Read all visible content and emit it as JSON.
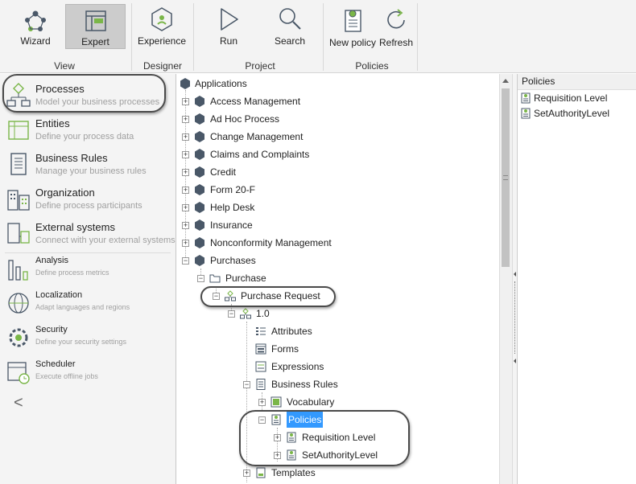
{
  "ribbon": {
    "buttons": {
      "wizard": "Wizard",
      "expert": "Expert",
      "experience": "Experience",
      "run": "Run",
      "search": "Search",
      "new_policy": "New policy",
      "refresh": "Refresh"
    },
    "groups": {
      "view": "View",
      "designer": "Designer",
      "project": "Project",
      "policies": "Policies"
    }
  },
  "sidebar": {
    "items": [
      {
        "title": "Processes",
        "subtitle": "Model your business processes"
      },
      {
        "title": "Entities",
        "subtitle": "Define your process data"
      },
      {
        "title": "Business Rules",
        "subtitle": "Manage your business rules"
      },
      {
        "title": "Organization",
        "subtitle": "Define process participants"
      },
      {
        "title": "External systems",
        "subtitle": "Connect with your external systems"
      },
      {
        "title": "Analysis",
        "subtitle": "Define process metrics"
      },
      {
        "title": "Localization",
        "subtitle": "Adapt languages and regions"
      },
      {
        "title": "Security",
        "subtitle": "Define your security settings"
      },
      {
        "title": "Scheduler",
        "subtitle": "Execute offline jobs"
      }
    ],
    "collapse_glyph": "<"
  },
  "tree": {
    "root": "Applications",
    "apps": [
      "Access Management",
      "Ad Hoc Process",
      "Change Management",
      "Claims and Complaints",
      "Credit",
      "Form 20-F",
      "Help Desk",
      "Insurance",
      "Nonconformity Management",
      "Purchases"
    ],
    "purchase": "Purchase",
    "purchase_request": "Purchase Request",
    "version": "1.0",
    "attributes": "Attributes",
    "forms": "Forms",
    "expressions": "Expressions",
    "business_rules": "Business Rules",
    "vocabulary": "Vocabulary",
    "policies": "Policies",
    "requisition_level": "Requisition Level",
    "set_authority_level": "SetAuthorityLevel",
    "templates": "Templates"
  },
  "right_panel": {
    "header": "Policies",
    "items": [
      "Requisition Level",
      "SetAuthorityLevel"
    ]
  },
  "colors": {
    "selection": "#3399ff",
    "ribbon_bg": "#f3f3f3",
    "active_button": "#cccccc",
    "icon_green": "#7ab648",
    "icon_dark": "#4a5868"
  }
}
